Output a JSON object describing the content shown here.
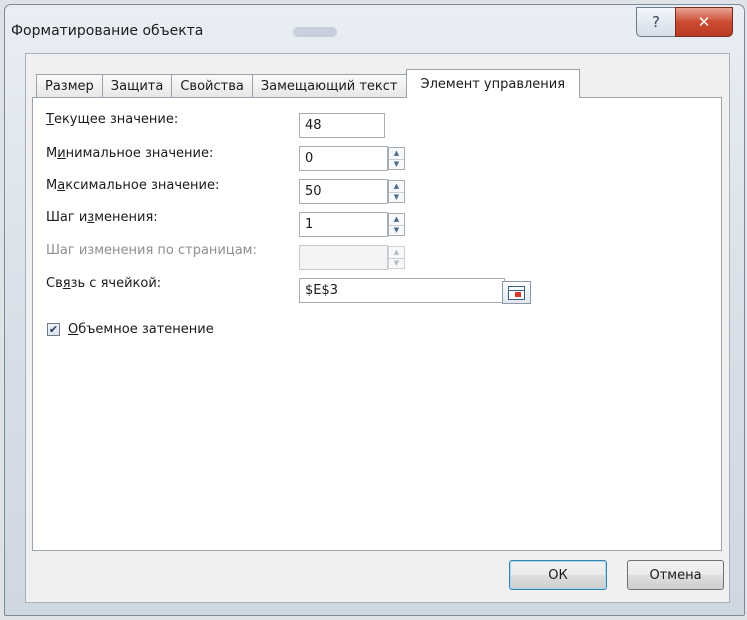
{
  "window": {
    "title": "Форматирование объекта",
    "help_glyph": "?",
    "close_glyph": "✕"
  },
  "tabs": [
    {
      "label": "Размер",
      "active": false
    },
    {
      "label": "Защита",
      "active": false
    },
    {
      "label": "Свойства",
      "active": false
    },
    {
      "label": "Замещающий текст",
      "active": false
    },
    {
      "label": "Элемент управления",
      "active": true
    }
  ],
  "form": {
    "current_value": {
      "label_hot": "Т",
      "label_rest": "екущее значение:",
      "value": "48"
    },
    "min_value": {
      "label_pre": "М",
      "label_hot": "и",
      "label_rest": "нимальное значение:",
      "value": "0"
    },
    "max_value": {
      "label_pre": "М",
      "label_hot": "а",
      "label_rest": "ксимальное значение:",
      "value": "50"
    },
    "step": {
      "label_pre": "Шаг и",
      "label_hot": "з",
      "label_rest": "менения:",
      "value": "1"
    },
    "page_step": {
      "label": "Шаг изменения по страницам:",
      "value": "",
      "disabled": true
    },
    "cell_link": {
      "label_pre": "Св",
      "label_hot": "я",
      "label_rest": "зь с ячейкой:",
      "value": "$E$3"
    },
    "shading": {
      "label_hot": "О",
      "label_rest": "бъемное затенение",
      "checked": true,
      "check_glyph": "✔"
    }
  },
  "buttons": {
    "ok": "ОК",
    "cancel": "Отмена"
  },
  "icons": {
    "help": "help-icon",
    "close": "close-icon",
    "spin_up": "spin-up-arrow-icon",
    "spin_down": "spin-down-arrow-icon",
    "cell_reference": "cell-reference-icon",
    "checkmark": "checkmark-icon"
  },
  "colors": {
    "close_button": "#cc4b33",
    "ok_border": "#3c7fb1",
    "disabled_text": "#8e8e8e"
  }
}
